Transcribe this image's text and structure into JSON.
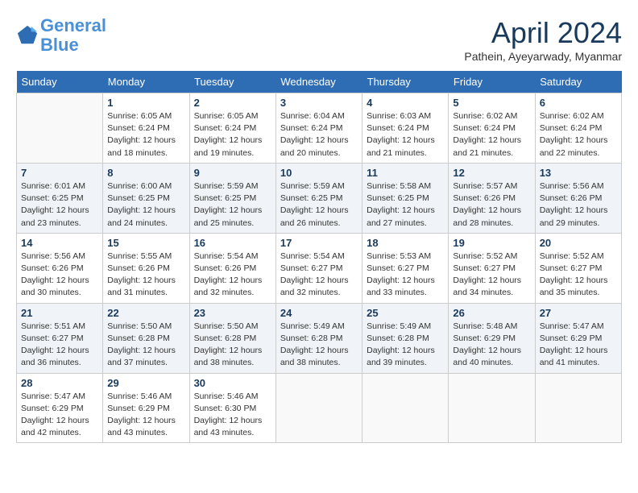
{
  "logo": {
    "line1": "General",
    "line2": "Blue"
  },
  "title": "April 2024",
  "subtitle": "Pathein, Ayeyarwady, Myanmar",
  "days_header": [
    "Sunday",
    "Monday",
    "Tuesday",
    "Wednesday",
    "Thursday",
    "Friday",
    "Saturday"
  ],
  "weeks": [
    [
      {
        "num": "",
        "info": ""
      },
      {
        "num": "1",
        "info": "Sunrise: 6:05 AM\nSunset: 6:24 PM\nDaylight: 12 hours\nand 18 minutes."
      },
      {
        "num": "2",
        "info": "Sunrise: 6:05 AM\nSunset: 6:24 PM\nDaylight: 12 hours\nand 19 minutes."
      },
      {
        "num": "3",
        "info": "Sunrise: 6:04 AM\nSunset: 6:24 PM\nDaylight: 12 hours\nand 20 minutes."
      },
      {
        "num": "4",
        "info": "Sunrise: 6:03 AM\nSunset: 6:24 PM\nDaylight: 12 hours\nand 21 minutes."
      },
      {
        "num": "5",
        "info": "Sunrise: 6:02 AM\nSunset: 6:24 PM\nDaylight: 12 hours\nand 21 minutes."
      },
      {
        "num": "6",
        "info": "Sunrise: 6:02 AM\nSunset: 6:24 PM\nDaylight: 12 hours\nand 22 minutes."
      }
    ],
    [
      {
        "num": "7",
        "info": "Sunrise: 6:01 AM\nSunset: 6:25 PM\nDaylight: 12 hours\nand 23 minutes."
      },
      {
        "num": "8",
        "info": "Sunrise: 6:00 AM\nSunset: 6:25 PM\nDaylight: 12 hours\nand 24 minutes."
      },
      {
        "num": "9",
        "info": "Sunrise: 5:59 AM\nSunset: 6:25 PM\nDaylight: 12 hours\nand 25 minutes."
      },
      {
        "num": "10",
        "info": "Sunrise: 5:59 AM\nSunset: 6:25 PM\nDaylight: 12 hours\nand 26 minutes."
      },
      {
        "num": "11",
        "info": "Sunrise: 5:58 AM\nSunset: 6:25 PM\nDaylight: 12 hours\nand 27 minutes."
      },
      {
        "num": "12",
        "info": "Sunrise: 5:57 AM\nSunset: 6:26 PM\nDaylight: 12 hours\nand 28 minutes."
      },
      {
        "num": "13",
        "info": "Sunrise: 5:56 AM\nSunset: 6:26 PM\nDaylight: 12 hours\nand 29 minutes."
      }
    ],
    [
      {
        "num": "14",
        "info": "Sunrise: 5:56 AM\nSunset: 6:26 PM\nDaylight: 12 hours\nand 30 minutes."
      },
      {
        "num": "15",
        "info": "Sunrise: 5:55 AM\nSunset: 6:26 PM\nDaylight: 12 hours\nand 31 minutes."
      },
      {
        "num": "16",
        "info": "Sunrise: 5:54 AM\nSunset: 6:26 PM\nDaylight: 12 hours\nand 32 minutes."
      },
      {
        "num": "17",
        "info": "Sunrise: 5:54 AM\nSunset: 6:27 PM\nDaylight: 12 hours\nand 32 minutes."
      },
      {
        "num": "18",
        "info": "Sunrise: 5:53 AM\nSunset: 6:27 PM\nDaylight: 12 hours\nand 33 minutes."
      },
      {
        "num": "19",
        "info": "Sunrise: 5:52 AM\nSunset: 6:27 PM\nDaylight: 12 hours\nand 34 minutes."
      },
      {
        "num": "20",
        "info": "Sunrise: 5:52 AM\nSunset: 6:27 PM\nDaylight: 12 hours\nand 35 minutes."
      }
    ],
    [
      {
        "num": "21",
        "info": "Sunrise: 5:51 AM\nSunset: 6:27 PM\nDaylight: 12 hours\nand 36 minutes."
      },
      {
        "num": "22",
        "info": "Sunrise: 5:50 AM\nSunset: 6:28 PM\nDaylight: 12 hours\nand 37 minutes."
      },
      {
        "num": "23",
        "info": "Sunrise: 5:50 AM\nSunset: 6:28 PM\nDaylight: 12 hours\nand 38 minutes."
      },
      {
        "num": "24",
        "info": "Sunrise: 5:49 AM\nSunset: 6:28 PM\nDaylight: 12 hours\nand 38 minutes."
      },
      {
        "num": "25",
        "info": "Sunrise: 5:49 AM\nSunset: 6:28 PM\nDaylight: 12 hours\nand 39 minutes."
      },
      {
        "num": "26",
        "info": "Sunrise: 5:48 AM\nSunset: 6:29 PM\nDaylight: 12 hours\nand 40 minutes."
      },
      {
        "num": "27",
        "info": "Sunrise: 5:47 AM\nSunset: 6:29 PM\nDaylight: 12 hours\nand 41 minutes."
      }
    ],
    [
      {
        "num": "28",
        "info": "Sunrise: 5:47 AM\nSunset: 6:29 PM\nDaylight: 12 hours\nand 42 minutes."
      },
      {
        "num": "29",
        "info": "Sunrise: 5:46 AM\nSunset: 6:29 PM\nDaylight: 12 hours\nand 43 minutes."
      },
      {
        "num": "30",
        "info": "Sunrise: 5:46 AM\nSunset: 6:30 PM\nDaylight: 12 hours\nand 43 minutes."
      },
      {
        "num": "",
        "info": ""
      },
      {
        "num": "",
        "info": ""
      },
      {
        "num": "",
        "info": ""
      },
      {
        "num": "",
        "info": ""
      }
    ]
  ]
}
